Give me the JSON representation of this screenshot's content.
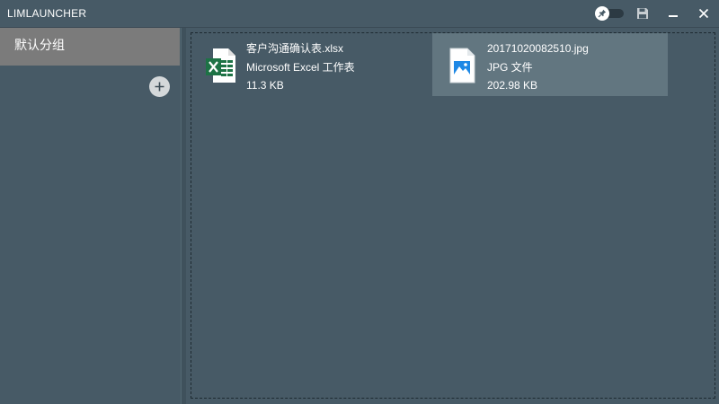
{
  "app": {
    "title": "LIMLAUNCHER"
  },
  "titlebar": {
    "pin_toggle": {
      "icon": "pin-icon",
      "state": "off"
    },
    "buttons": [
      {
        "name": "save",
        "icon": "save-icon"
      },
      {
        "name": "minimize",
        "icon": "minimize-icon"
      },
      {
        "name": "close",
        "icon": "close-icon"
      }
    ]
  },
  "sidebar": {
    "groups": [
      {
        "label": "默认分组",
        "selected": true
      }
    ],
    "add_button_icon": "plus-icon"
  },
  "files": [
    {
      "name": "客户沟通确认表.xlsx",
      "type": "Microsoft Excel 工作表",
      "size": "11.3 KB",
      "icon": "excel-file-icon",
      "selected": false
    },
    {
      "name": "20171020082510.jpg",
      "type": "JPG 文件",
      "size": "202.98 KB",
      "icon": "image-file-icon",
      "selected": true
    }
  ],
  "colors": {
    "background": "#475a66",
    "selected_group": "#7b7b7b",
    "selected_file": "#627680",
    "excel_green": "#1d7245",
    "image_blue": "#1e88e5"
  }
}
